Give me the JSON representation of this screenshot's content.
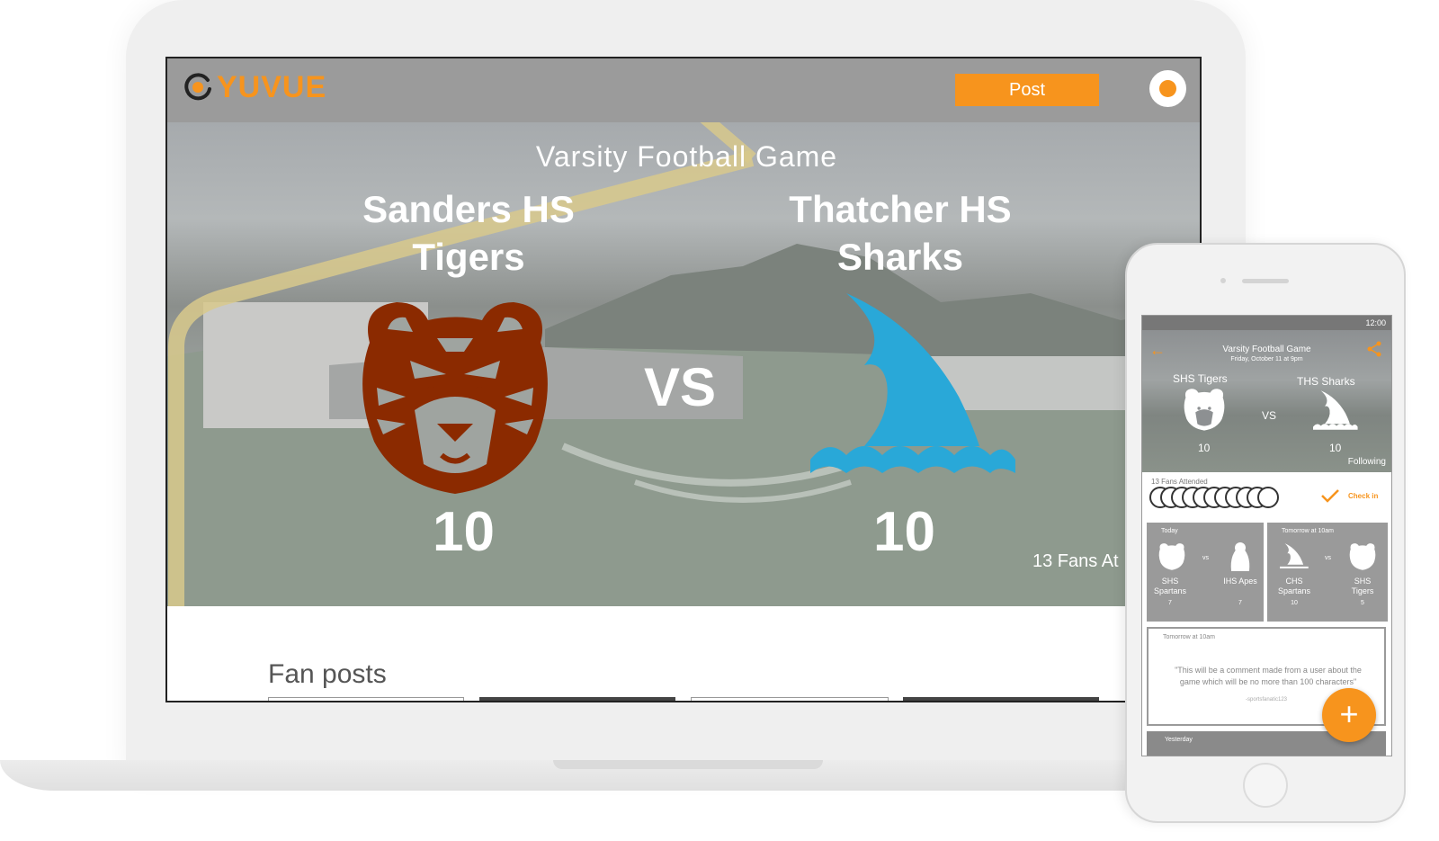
{
  "laptop": {
    "brand": "YUVUE",
    "post_button": "Post",
    "event_title": "Varsity Football Game",
    "home_team": "Sanders HS Tigers",
    "away_team": "Thatcher HS Sharks",
    "vs": "VS",
    "home_score": "10",
    "away_score": "10",
    "fans_text": "13 Fans At",
    "fan_posts_heading": "Fan posts"
  },
  "phone": {
    "status_time": "12:00",
    "event_title": "Varsity Football Game",
    "event_date": "Friday, October 11 at 9pm",
    "home_team": "SHS Tigers",
    "away_team": "THS Sharks",
    "vs": "VS",
    "home_score": "10",
    "away_score": "10",
    "following": "Following",
    "fans_attended": "13 Fans Attended",
    "check_in": "Check in",
    "cards": [
      {
        "when": "Today",
        "team1": "SHS Spartans",
        "score1": "7",
        "vs": "vs",
        "team2": "IHS Apes",
        "score2": "7"
      },
      {
        "when": "Tomorrow at 10am",
        "team1": "CHS Spartans",
        "score1": "10",
        "vs": "vs",
        "team2": "SHS Tigers",
        "score2": "5"
      }
    ],
    "comment_when": "Tomorrow at 10am",
    "comment_text": "\"This will be a comment made from a user about the game which will be no more than 100 characters\"",
    "comment_author": "-sportsfanatic123",
    "yesterday": "Yesterday",
    "fab": "+"
  },
  "colors": {
    "accent": "#f7941d",
    "tiger": "#8b2a00",
    "shark": "#29a8d8",
    "bar": "#9b9b9b"
  }
}
